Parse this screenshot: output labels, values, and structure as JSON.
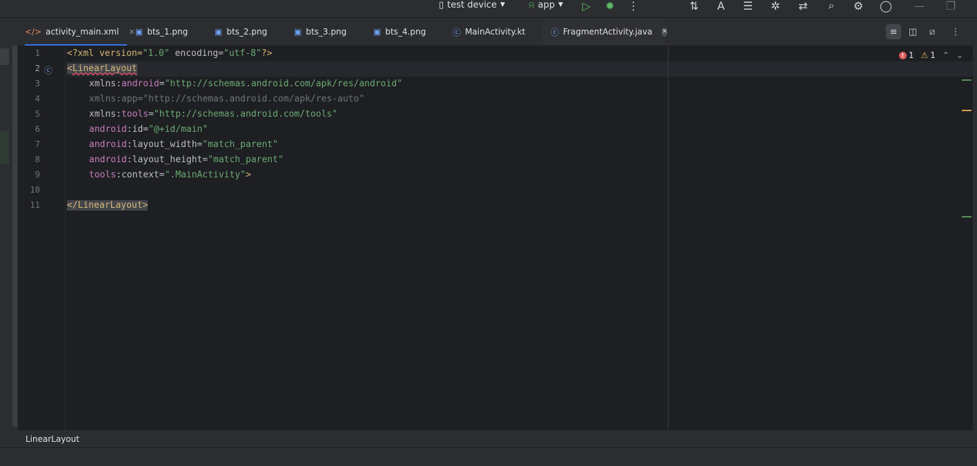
{
  "toolbar": {
    "device_label": "test device",
    "config_label": "app",
    "icons": [
      "device-icon",
      "android-icon",
      "run-icon",
      "debug-icon",
      "more-icon",
      "sync-icon",
      "translate-icon",
      "build-icon",
      "profiler-icon",
      "device-manager-icon",
      "search-icon",
      "settings-icon",
      "account-icon",
      "minimize-icon",
      "restore-icon"
    ]
  },
  "tabs": [
    {
      "label": "activity_main.xml",
      "icon": "xml-icon",
      "active": true
    },
    {
      "label": "bts_1.png",
      "icon": "image-icon"
    },
    {
      "label": "bts_2.png",
      "icon": "image-icon"
    },
    {
      "label": "bts_3.png",
      "icon": "image-icon"
    },
    {
      "label": "bts_4.png",
      "icon": "image-icon"
    },
    {
      "label": "MainActivity.kt",
      "icon": "kotlin-class-icon"
    },
    {
      "label": "FragmentActivity.java",
      "icon": "java-class-icon",
      "selected": true
    }
  ],
  "editor": {
    "line_numbers": [
      "1",
      "2",
      "3",
      "4",
      "5",
      "6",
      "7",
      "8",
      "9",
      "10",
      "11"
    ],
    "current_line": 2,
    "code": {
      "l1_a": "<?xml version=",
      "l1_b": "\"1.0\"",
      "l1_c": " encoding=",
      "l1_d": "\"utf-8\"",
      "l1_e": "?>",
      "l2_a": "<",
      "l2_b": "LinearLayout",
      "l3_a": "xmlns:",
      "l3_b": "android",
      "l3_c": "=",
      "l3_d": "\"http://schemas.android.com/apk/res/android\"",
      "l4": "xmlns:app=\"http://schemas.android.com/apk/res-auto\"",
      "l5_a": "xmlns:",
      "l5_b": "tools",
      "l5_c": "=",
      "l5_d": "\"http://schemas.android.com/tools\"",
      "l6_a": "android",
      "l6_b": ":id=",
      "l6_c": "\"@+id/main\"",
      "l7_a": "android",
      "l7_b": ":layout_width=",
      "l7_c": "\"match_parent\"",
      "l8_a": "android",
      "l8_b": ":layout_height=",
      "l8_c": "\"match_parent\"",
      "l9_a": "tools",
      "l9_b": ":context=",
      "l9_c": "\".MainActivity\"",
      "l9_d": ">",
      "l11": "</LinearLayout>"
    },
    "inspections": {
      "errors": "1",
      "warnings": "1"
    }
  },
  "breadcrumb": {
    "path": "LinearLayout"
  },
  "colors": {
    "accent": "#3574f0",
    "error": "#db5c5c",
    "warning": "#e0b75a",
    "string": "#6aab73",
    "tag": "#d5b778",
    "namespace": "#c77dbb"
  }
}
